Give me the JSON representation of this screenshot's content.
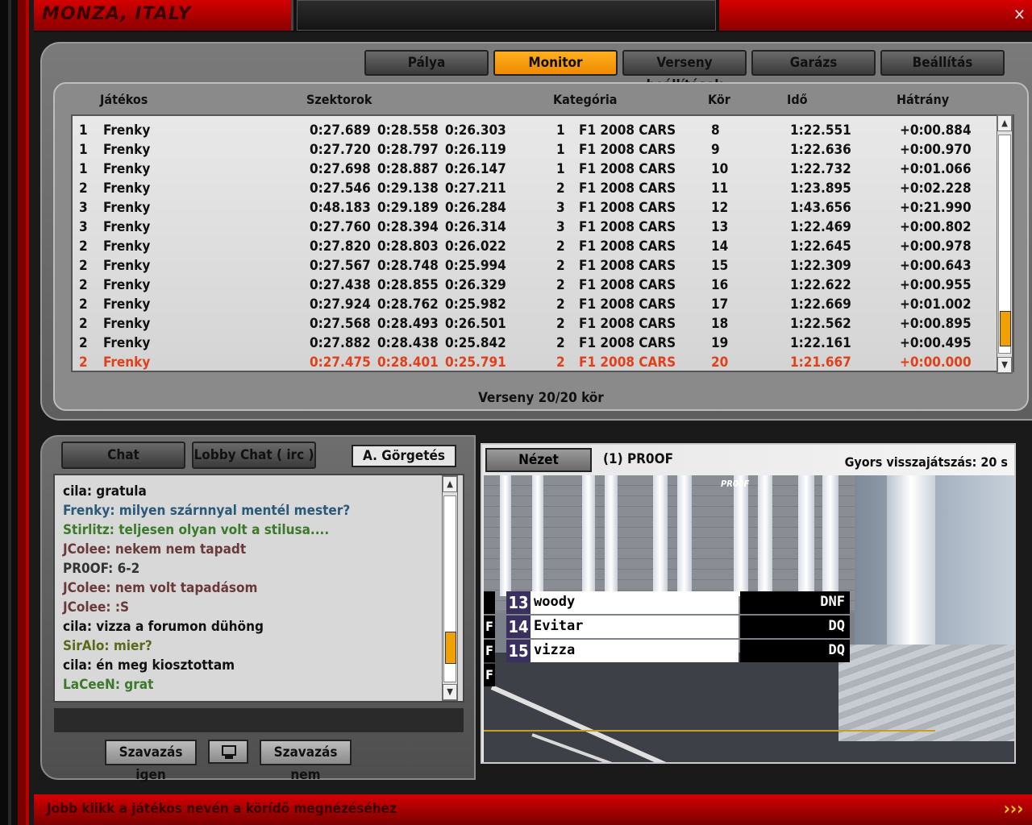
{
  "window": {
    "title": "MONZA, ITALY",
    "close_label": "✕"
  },
  "tabs": [
    {
      "label": "Pálya",
      "active": false
    },
    {
      "label": "Monitor",
      "active": true
    },
    {
      "label": "Verseny beállítások",
      "active": false
    },
    {
      "label": "Garázs",
      "active": false
    },
    {
      "label": "Beállítás",
      "active": false
    }
  ],
  "results": {
    "headers": {
      "player": "Játékos",
      "sectors": "Szektorok",
      "category": "Kategória",
      "lap": "Kör",
      "time": "Idő",
      "gap": "Hátrány"
    },
    "rows": [
      {
        "pos": "1",
        "player": "Frenky",
        "s1": "0:27.689",
        "s2": "0:28.558",
        "s3": "0:26.303",
        "catnum": "1",
        "category": "F1 2008 CARS",
        "lap": "8",
        "time": "1:22.551",
        "gap": "+0:00.884"
      },
      {
        "pos": "1",
        "player": "Frenky",
        "s1": "0:27.720",
        "s2": "0:28.797",
        "s3": "0:26.119",
        "catnum": "1",
        "category": "F1 2008 CARS",
        "lap": "9",
        "time": "1:22.636",
        "gap": "+0:00.970"
      },
      {
        "pos": "1",
        "player": "Frenky",
        "s1": "0:27.698",
        "s2": "0:28.887",
        "s3": "0:26.147",
        "catnum": "1",
        "category": "F1 2008 CARS",
        "lap": "10",
        "time": "1:22.732",
        "gap": "+0:01.066"
      },
      {
        "pos": "2",
        "player": "Frenky",
        "s1": "0:27.546",
        "s2": "0:29.138",
        "s3": "0:27.211",
        "catnum": "2",
        "category": "F1 2008 CARS",
        "lap": "11",
        "time": "1:23.895",
        "gap": "+0:02.228"
      },
      {
        "pos": "3",
        "player": "Frenky",
        "s1": "0:48.183",
        "s2": "0:29.189",
        "s3": "0:26.284",
        "catnum": "3",
        "category": "F1 2008 CARS",
        "lap": "12",
        "time": "1:43.656",
        "gap": "+0:21.990"
      },
      {
        "pos": "3",
        "player": "Frenky",
        "s1": "0:27.760",
        "s2": "0:28.394",
        "s3": "0:26.314",
        "catnum": "3",
        "category": "F1 2008 CARS",
        "lap": "13",
        "time": "1:22.469",
        "gap": "+0:00.802"
      },
      {
        "pos": "2",
        "player": "Frenky",
        "s1": "0:27.820",
        "s2": "0:28.803",
        "s3": "0:26.022",
        "catnum": "2",
        "category": "F1 2008 CARS",
        "lap": "14",
        "time": "1:22.645",
        "gap": "+0:00.978"
      },
      {
        "pos": "2",
        "player": "Frenky",
        "s1": "0:27.567",
        "s2": "0:28.748",
        "s3": "0:25.994",
        "catnum": "2",
        "category": "F1 2008 CARS",
        "lap": "15",
        "time": "1:22.309",
        "gap": "+0:00.643"
      },
      {
        "pos": "2",
        "player": "Frenky",
        "s1": "0:27.438",
        "s2": "0:28.855",
        "s3": "0:26.329",
        "catnum": "2",
        "category": "F1 2008 CARS",
        "lap": "16",
        "time": "1:22.622",
        "gap": "+0:00.955"
      },
      {
        "pos": "2",
        "player": "Frenky",
        "s1": "0:27.924",
        "s2": "0:28.762",
        "s3": "0:25.982",
        "catnum": "2",
        "category": "F1 2008 CARS",
        "lap": "17",
        "time": "1:22.669",
        "gap": "+0:01.002"
      },
      {
        "pos": "2",
        "player": "Frenky",
        "s1": "0:27.568",
        "s2": "0:28.493",
        "s3": "0:26.501",
        "catnum": "2",
        "category": "F1 2008 CARS",
        "lap": "18",
        "time": "1:22.562",
        "gap": "+0:00.895"
      },
      {
        "pos": "2",
        "player": "Frenky",
        "s1": "0:27.882",
        "s2": "0:28.438",
        "s3": "0:25.842",
        "catnum": "2",
        "category": "F1 2008 CARS",
        "lap": "19",
        "time": "1:22.161",
        "gap": "+0:00.495"
      },
      {
        "pos": "2",
        "player": "Frenky",
        "s1": "0:27.475",
        "s2": "0:28.401",
        "s3": "0:25.791",
        "catnum": "2",
        "category": "F1 2008 CARS",
        "lap": "20",
        "time": "1:21.667",
        "gap": "+0:00.000",
        "highlight": true
      }
    ],
    "race_status": "Verseny   20/20 kör",
    "highlight_color": "#e0401a"
  },
  "chat": {
    "tabs": [
      "Chat",
      "Lobby Chat ( irc )"
    ],
    "autoscroll_label": "A. Görgetés",
    "messages": [
      {
        "text": "cila: gratula",
        "color": "#111111"
      },
      {
        "text": "Frenky: milyen szárnnyal mentél mester?",
        "color": "#2a5a78"
      },
      {
        "text": "Stirlitz: teljesen olyan volt a stilusa....",
        "color": "#3a7a2a"
      },
      {
        "text": "JColee: nekem nem tapadt",
        "color": "#6a3a3a"
      },
      {
        "text": "PR0OF: 6-2",
        "color": "#333333"
      },
      {
        "text": "JColee: nem volt tapadásom",
        "color": "#6a3a3a"
      },
      {
        "text": "JColee: :S",
        "color": "#6a3a3a"
      },
      {
        "text": "cila: vizza a forumon dühöng",
        "color": "#111111"
      },
      {
        "text": "SirAlo: mier?",
        "color": "#5a6a1a"
      },
      {
        "text": "cila: én meg kiosztottam",
        "color": "#111111"
      },
      {
        "text": "LaCeeN: grat",
        "color": "#3a7a2a"
      }
    ],
    "vote_yes": "Szavazás igen",
    "vote_no": "Szavazás nem"
  },
  "viewer": {
    "view_label": "Nézet",
    "driver": "(1) PR0OF",
    "replay": "Gyors visszajátszás: 20 s",
    "car_tag": "PR00F",
    "standings": [
      {
        "flag": "",
        "num": "13",
        "name": "woody",
        "status": "DNF"
      },
      {
        "flag": "F",
        "num": "14",
        "name": "Evitar",
        "status": "DQ"
      },
      {
        "flag": "F",
        "num": "15",
        "name": "vizza",
        "status": "DQ"
      }
    ],
    "extra_flag": "F"
  },
  "footer": {
    "hint": "Jobb klikk a játékos nevén a körídő megnézéséhez",
    "next_icon": "›››"
  }
}
